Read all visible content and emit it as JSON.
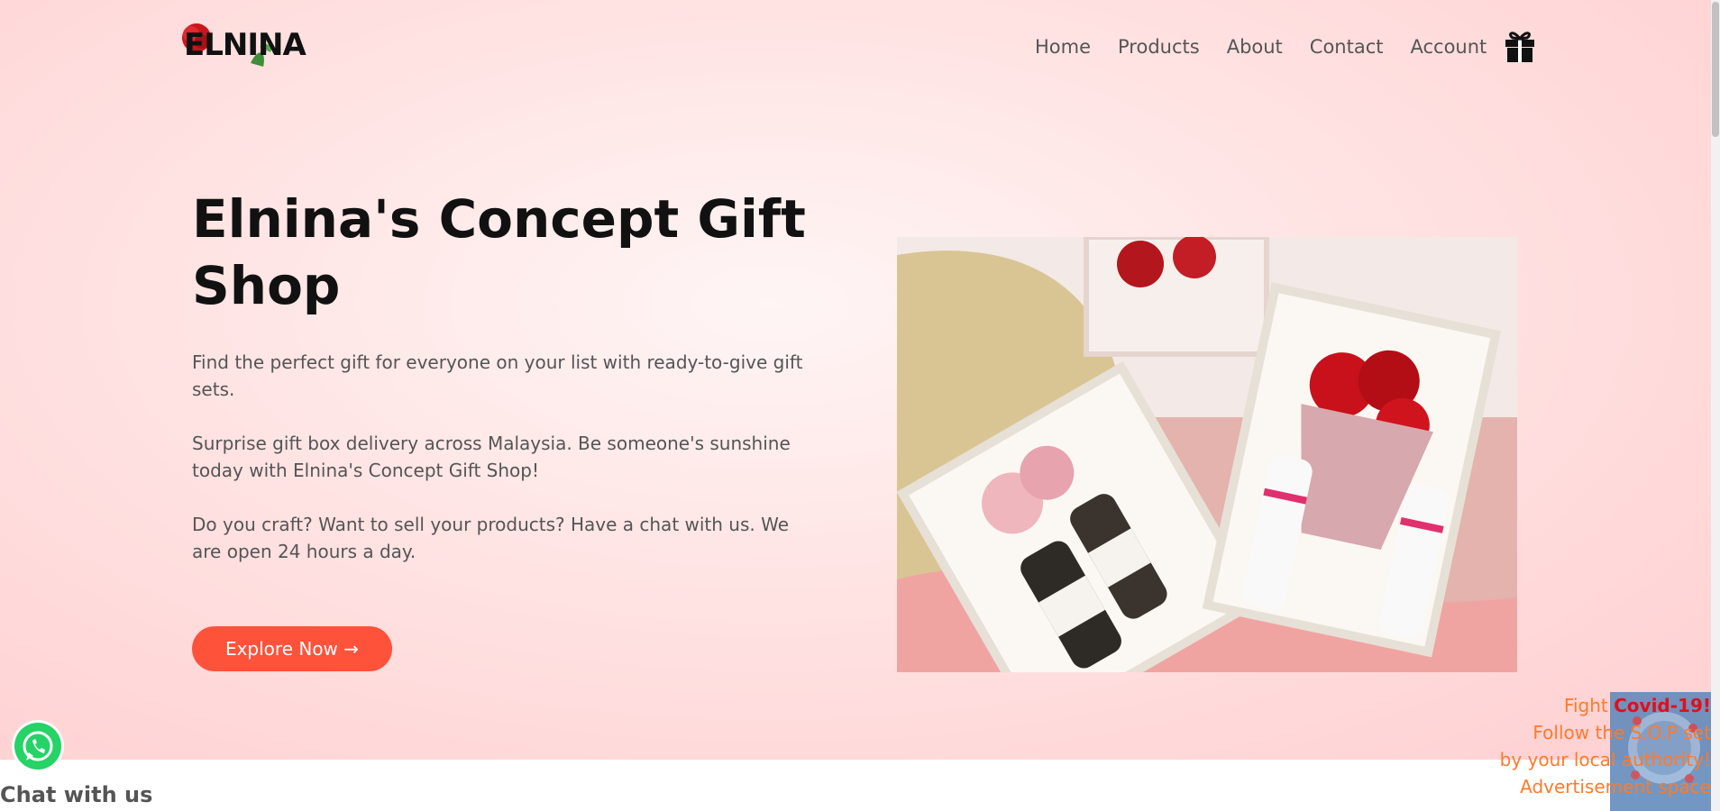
{
  "brand": {
    "logo_text": "ELNINA"
  },
  "nav": {
    "links": [
      "Home",
      "Products",
      "About",
      "Contact",
      "Account"
    ],
    "cart_icon": "gift-icon"
  },
  "hero": {
    "title": "Elnina's Concept Gift Shop",
    "paragraphs": [
      "Find the perfect gift for everyone on your list with ready-to-give gift sets.",
      "Surprise gift box delivery across Malaysia. Be someone's sunshine today with Elnina's Concept Gift Shop!",
      "Do you craft? Want to sell your products? Have a chat with us. We are open 24 hours a day."
    ],
    "cta_label": "Explore Now →",
    "image_icon": "gift-box-photo"
  },
  "chat": {
    "label": "Chat with us",
    "icon": "whatsapp-icon"
  },
  "ad": {
    "line1_prefix": "Fight ",
    "line1_highlight": "Covid-19!",
    "line2": "Follow the S.O.P set",
    "line3": "by your local authority!",
    "line4": "Advertisement space"
  },
  "colors": {
    "accent": "#ff523b",
    "hero_bg": "#ffe3e3",
    "ad_text": "#ff7a2a",
    "ad_highlight": "#e0101a"
  }
}
